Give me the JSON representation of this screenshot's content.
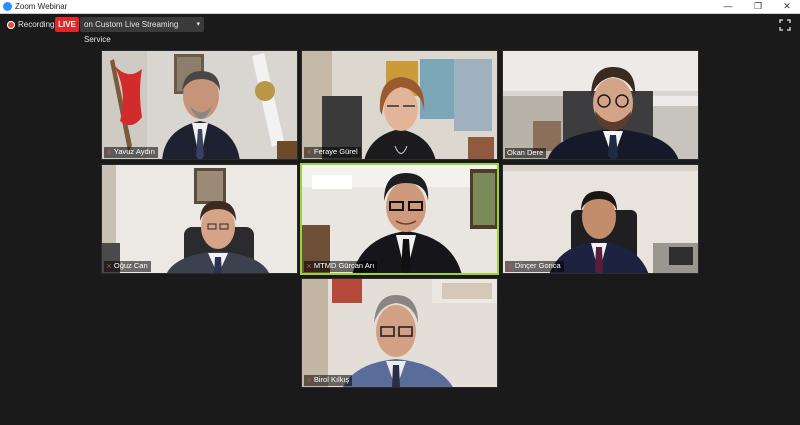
{
  "window": {
    "title": "Zoom Webinar",
    "minimize": "—",
    "maximize": "❐",
    "close": "✕"
  },
  "toolbar": {
    "recording_label": "Recording",
    "live_label": "LIVE",
    "stream_target": "on Custom Live Streaming Service",
    "stream_chevron": "▾"
  },
  "participants": [
    {
      "name": "Yavuz Aydın",
      "muted": true
    },
    {
      "name": "Feraye Gürel",
      "muted": true
    },
    {
      "name": "Okan Dere",
      "muted": false
    },
    {
      "name": "Oğuz Can",
      "muted": true
    },
    {
      "name": "MTMD Gürcan Arı",
      "muted": true,
      "active_speaker": true
    },
    {
      "name": "Dinçer Gonca",
      "muted": true
    },
    {
      "name": "Birol Kılkış",
      "muted": true
    }
  ],
  "colors": {
    "live": "#e02828",
    "active_border": "#9bd33b",
    "mute_icon": "#e54b3c",
    "background": "#1a1a1a"
  }
}
